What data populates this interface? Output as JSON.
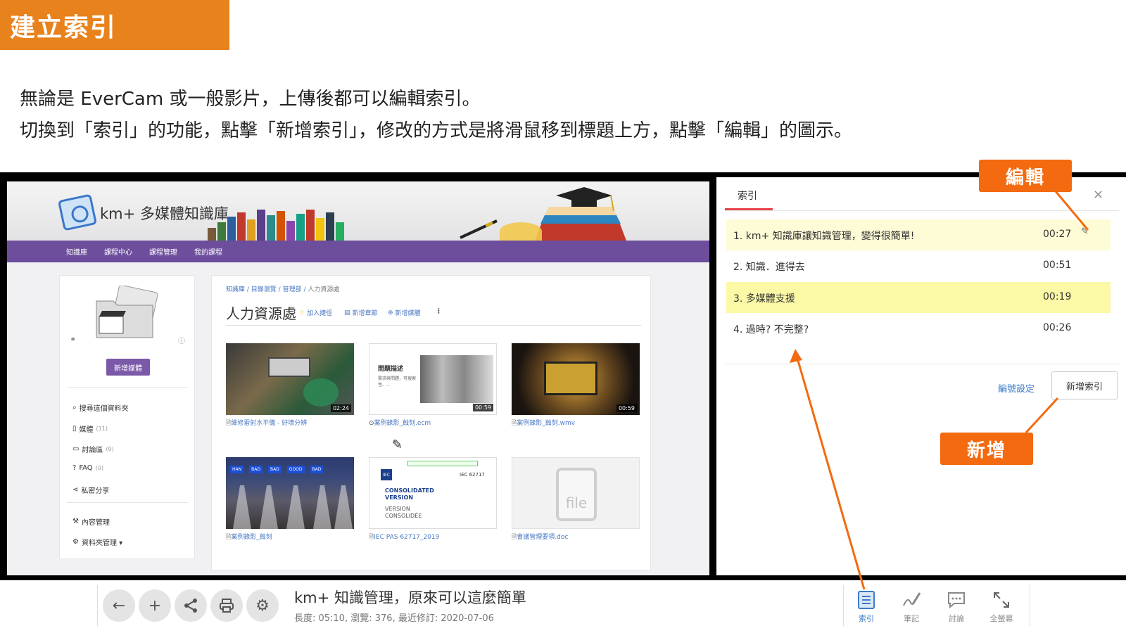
{
  "slide": {
    "title": "建立索引",
    "line1": "無論是 EverCam 或一般影片，上傳後都可以編輯索引。",
    "line2": "切換到「索引」的功能，點擊「新增索引」，修改的方式是將滑鼠移到標題上方，點擊「編輯」的圖示。"
  },
  "callouts": {
    "edit": "編輯",
    "add": "新增"
  },
  "site": {
    "name": "km+ 多媒體知識庫",
    "nav": [
      "知識庫",
      "課程中心",
      "課程管理",
      "我的課程"
    ],
    "sidebar": {
      "new_media_button": "新增媒體",
      "items": [
        {
          "icon": "search-icon",
          "label": "搜尋這個資料夾",
          "count": ""
        },
        {
          "icon": "document-icon",
          "label": "媒體",
          "count": "(11)"
        },
        {
          "icon": "chat-icon",
          "label": "討論區",
          "count": "(0)"
        },
        {
          "icon": "question-icon",
          "label": "FAQ",
          "count": "(0)"
        },
        {
          "icon": "share-icon",
          "label": "私密分享",
          "count": ""
        },
        {
          "icon": "wrench-icon",
          "label": "內容管理",
          "count": ""
        },
        {
          "icon": "gear-icon",
          "label": "資料夾管理 ▾",
          "count": ""
        }
      ]
    },
    "breadcrumb": [
      "知識庫",
      "目錄瀏覽",
      "管理部",
      "人力資源處"
    ],
    "folder_title": "人力資源處",
    "folder_actions": {
      "favorite": "加入捷徑",
      "chapter": "新增章節",
      "add_media": "新增媒體"
    },
    "media": [
      {
        "caption": "維修雷射水平儀 - 好壞分辨",
        "duration": "02:24"
      },
      {
        "caption": "案例錄影_蝕刻.ecm",
        "duration": "00:59"
      },
      {
        "caption": "案例錄影_蝕刻.wmv",
        "duration": "00:59"
      },
      {
        "caption": "案例錄影_蝕刻",
        "duration": ""
      },
      {
        "caption": "IEC PAS 62717_2019",
        "duration": ""
      },
      {
        "caption": "會議管理要領.doc",
        "duration": ""
      }
    ],
    "thumb_text": {
      "slide_heading": "問題描述",
      "slide_body": "需求與問題，可搜索性、...",
      "iec": "IEC",
      "iec_code": "IEC 62717",
      "consolidated": "CONSOLIDATED VERSION",
      "version_fr": "VERSION CONSOLIDÉE",
      "file_word": "file",
      "nozzle_tags": [
        "HAN",
        "BAD",
        "BAD",
        "GOOD",
        "BAD"
      ]
    }
  },
  "index_panel": {
    "tab": "索引",
    "close": "×",
    "rows": [
      {
        "title": "1. km+ 知識庫讓知識管理，變得很簡單!",
        "time": "00:27"
      },
      {
        "title": "2. 知識．進得去",
        "time": "00:51"
      },
      {
        "title": "3. 多媒體支援",
        "time": "00:19"
      },
      {
        "title": "4. 過時? 不完整?",
        "time": "00:26"
      }
    ],
    "numbering_settings": "編號設定",
    "add_index_button": "新增索引"
  },
  "player": {
    "title": "km+ 知識管理，原來可以這麼簡單",
    "meta": "長度: 05:10, 瀏覽: 376, 最近修訂: 2020-07-06",
    "tools": [
      {
        "icon": "index-list-icon",
        "label": "索引"
      },
      {
        "icon": "note-pen-icon",
        "label": "筆記"
      },
      {
        "icon": "comment-icon",
        "label": "討論"
      },
      {
        "icon": "fullscreen-icon",
        "label": "全螢幕"
      }
    ]
  },
  "colors": {
    "accent_orange": "#e8821c",
    "callout_orange": "#f36a10",
    "nav_purple": "#6c4e9c",
    "highlight_yellow": "#fbf8a6"
  }
}
